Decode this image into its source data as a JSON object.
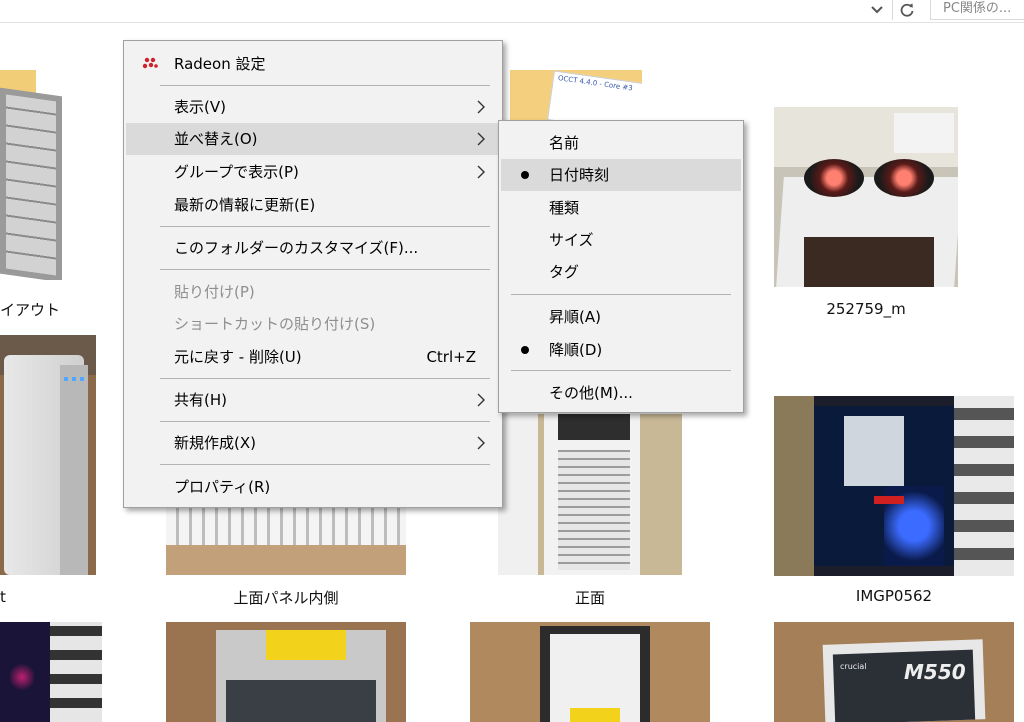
{
  "addressbar": {
    "search_placeholder": "PC関係の..."
  },
  "captions": {
    "c_layout": "イアウト",
    "c_252759": "252759_m",
    "c_left_frag": "t",
    "c_top_panel": "上面パネル内側",
    "c_front": "正面",
    "c_imgp": "IMGP0562"
  },
  "context_menu": {
    "radeon": "Radeon 設定",
    "view": "表示(V)",
    "sort": "並べ替え(O)",
    "group": "グループで表示(P)",
    "refresh": "最新の情報に更新(E)",
    "customize": "このフォルダーのカスタマイズ(F)...",
    "paste": "貼り付け(P)",
    "paste_shortcut": "ショートカットの貼り付け(S)",
    "undo": "元に戻す - 削除(U)",
    "undo_shortcut": "Ctrl+Z",
    "share": "共有(H)",
    "new": "新規作成(X)",
    "properties": "プロパティ(R)"
  },
  "sort_submenu": {
    "name": "名前",
    "date": "日付時刻",
    "type": "種類",
    "size": "サイズ",
    "tags": "タグ",
    "ascending": "昇順(A)",
    "descending": "降順(D)",
    "more": "その他(M)...",
    "selected_field": "日付時刻",
    "selected_order": "降順(D)"
  },
  "folder_preview": {
    "text": "OCCT 4.4.0 - Core #3"
  },
  "ssd_label": "M550",
  "ssd_brand": "crucial",
  "colors": {
    "menu_bg": "#f2f2f2",
    "highlight": "#dadada",
    "radeon_red": "#d0202b"
  }
}
